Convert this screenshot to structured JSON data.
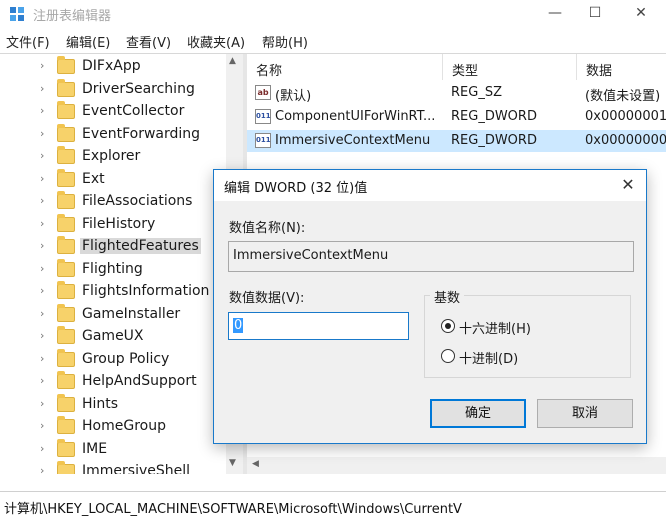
{
  "window": {
    "title": "注册表编辑器",
    "minimize": "—",
    "maximize": "☐",
    "close": "✕"
  },
  "menu": [
    "文件(F)",
    "编辑(E)",
    "查看(V)",
    "收藏夹(A)",
    "帮助(H)"
  ],
  "tree": {
    "items": [
      "DIFxApp",
      "DriverSearching",
      "EventCollector",
      "EventForwarding",
      "Explorer",
      "Ext",
      "FileAssociations",
      "FileHistory",
      "FlightedFeatures",
      "Flighting",
      "FlightsInformation",
      "GameInstaller",
      "GameUX",
      "Group Policy",
      "HelpAndSupport",
      "Hints",
      "HomeGroup",
      "IME",
      "ImmersiveShell"
    ],
    "selected_index": 8
  },
  "values": {
    "headers": {
      "name": "名称",
      "type": "类型",
      "data": "数据"
    },
    "rows": [
      {
        "icon": "string-value-icon",
        "badge": "ab",
        "name": "(默认)",
        "type": "REG_SZ",
        "data": "(数值未设置)"
      },
      {
        "icon": "dword-value-icon",
        "badge": "011",
        "name": "ComponentUIForWinRT...",
        "type": "REG_DWORD",
        "data": "0x00000001"
      },
      {
        "icon": "dword-value-icon",
        "badge": "011",
        "name": "ImmersiveContextMenu",
        "type": "REG_DWORD",
        "data": "0x00000000"
      }
    ],
    "selected_index": 2
  },
  "status": {
    "path": "计算机\\HKEY_LOCAL_MACHINE\\SOFTWARE\\Microsoft\\Windows\\CurrentV"
  },
  "dialog": {
    "title": "编辑 DWORD (32 位)值",
    "close": "✕",
    "name_label": "数值名称(N):",
    "name_value": "ImmersiveContextMenu",
    "data_label": "数值数据(V):",
    "data_value": "0",
    "base_label": "基数",
    "hex_label": "十六进制(H)",
    "dec_label": "十进制(D)",
    "hex_selected": true,
    "ok_label": "确定",
    "cancel_label": "取消"
  },
  "colors": {
    "accent": "#0078d7",
    "selection": "#cce8ff",
    "folder": "#f7d26a"
  }
}
